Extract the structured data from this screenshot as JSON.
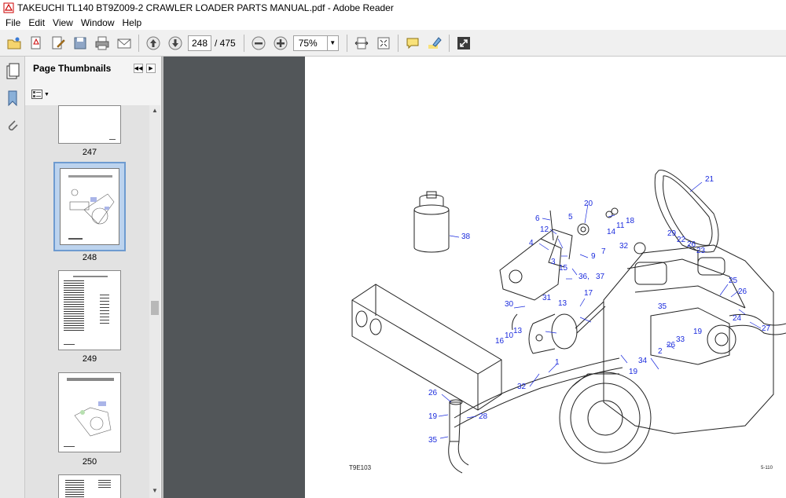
{
  "window": {
    "title": "TAKEUCHI TL140 BT9Z009-2 CRAWLER LOADER PARTS MANUAL.pdf - Adobe Reader"
  },
  "menu": [
    "File",
    "Edit",
    "View",
    "Window",
    "Help"
  ],
  "toolbar": {
    "current_page": "248",
    "total_pages": "/ 475",
    "zoom": "75%"
  },
  "panel": {
    "title": "Page Thumbnails",
    "thumbnails": [
      {
        "label": "247"
      },
      {
        "label": "248",
        "selected": true
      },
      {
        "label": "249"
      },
      {
        "label": "250"
      }
    ]
  },
  "page": {
    "figure_code": "T9E103",
    "page_ref": "5-110",
    "callouts": [
      "38",
      "20",
      "21",
      "6",
      "5",
      "12",
      "18",
      "11",
      "14",
      "4",
      "9",
      "7",
      "3",
      "15",
      "29",
      "22",
      "26",
      "23",
      "32",
      "36,",
      "37",
      "17",
      "13",
      "31",
      "30",
      "35",
      "25",
      "26",
      "24",
      "27",
      "16",
      "10",
      "13",
      "1",
      "2",
      "33",
      "26",
      "34",
      "19",
      "19",
      "32",
      "26",
      "19",
      "28",
      "35"
    ]
  },
  "colors": {
    "callout": "#1b2bdd",
    "doc_background": "#525659",
    "selection": "#6e9bd0"
  }
}
